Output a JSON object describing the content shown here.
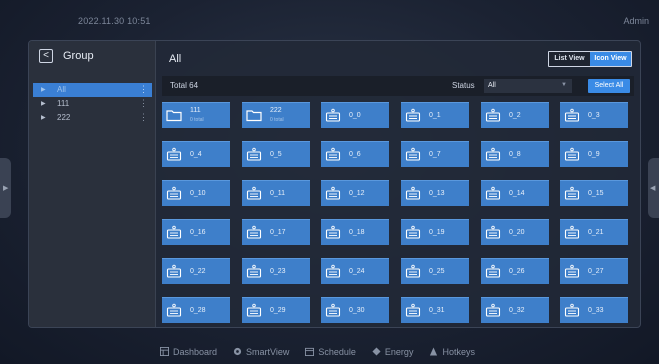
{
  "header": {
    "datetime": "2022.11.30   10:51",
    "user": "Admin"
  },
  "sidebar": {
    "title": "Group",
    "back_glyph": "<",
    "items": [
      {
        "label": "All",
        "selected": true
      },
      {
        "label": "111",
        "selected": false
      },
      {
        "label": "222",
        "selected": false
      }
    ],
    "more_glyph": "⋮"
  },
  "main": {
    "title": "All",
    "view_toggle": {
      "list": "List View",
      "icon": "Icon View",
      "active": "icon"
    },
    "total": "Total  64",
    "status_label": "Status",
    "status_value": "All",
    "select_all": "Select All",
    "tiles": [
      {
        "type": "group",
        "name": "111",
        "sub": "0 total"
      },
      {
        "type": "group",
        "name": "222",
        "sub": "0 total"
      },
      {
        "type": "device",
        "name": "0_0"
      },
      {
        "type": "device",
        "name": "0_1"
      },
      {
        "type": "device",
        "name": "0_2"
      },
      {
        "type": "device",
        "name": "0_3"
      },
      {
        "type": "device",
        "name": "0_4"
      },
      {
        "type": "device",
        "name": "0_5"
      },
      {
        "type": "device",
        "name": "0_6"
      },
      {
        "type": "device",
        "name": "0_7"
      },
      {
        "type": "device",
        "name": "0_8"
      },
      {
        "type": "device",
        "name": "0_9"
      },
      {
        "type": "device",
        "name": "0_10"
      },
      {
        "type": "device",
        "name": "0_11"
      },
      {
        "type": "device",
        "name": "0_12"
      },
      {
        "type": "device",
        "name": "0_13"
      },
      {
        "type": "device",
        "name": "0_14"
      },
      {
        "type": "device",
        "name": "0_15"
      },
      {
        "type": "device",
        "name": "0_16"
      },
      {
        "type": "device",
        "name": "0_17"
      },
      {
        "type": "device",
        "name": "0_18"
      },
      {
        "type": "device",
        "name": "0_19"
      },
      {
        "type": "device",
        "name": "0_20"
      },
      {
        "type": "device",
        "name": "0_21"
      },
      {
        "type": "device",
        "name": "0_22"
      },
      {
        "type": "device",
        "name": "0_23"
      },
      {
        "type": "device",
        "name": "0_24"
      },
      {
        "type": "device",
        "name": "0_25"
      },
      {
        "type": "device",
        "name": "0_26"
      },
      {
        "type": "device",
        "name": "0_27"
      },
      {
        "type": "device",
        "name": "0_28"
      },
      {
        "type": "device",
        "name": "0_29"
      },
      {
        "type": "device",
        "name": "0_30"
      },
      {
        "type": "device",
        "name": "0_31"
      },
      {
        "type": "device",
        "name": "0_32"
      },
      {
        "type": "device",
        "name": "0_33"
      }
    ]
  },
  "bottom_nav": [
    {
      "label": "Dashboard",
      "icon": "dashboard-icon"
    },
    {
      "label": "SmartView",
      "icon": "smartview-icon"
    },
    {
      "label": "Schedule",
      "icon": "schedule-icon"
    },
    {
      "label": "Energy",
      "icon": "energy-icon"
    },
    {
      "label": "Hotkeys",
      "icon": "hotkeys-icon"
    }
  ],
  "colors": {
    "accent": "#3a8be6",
    "tile": "#3e7fca",
    "selected_row": "#3a7fd4"
  }
}
